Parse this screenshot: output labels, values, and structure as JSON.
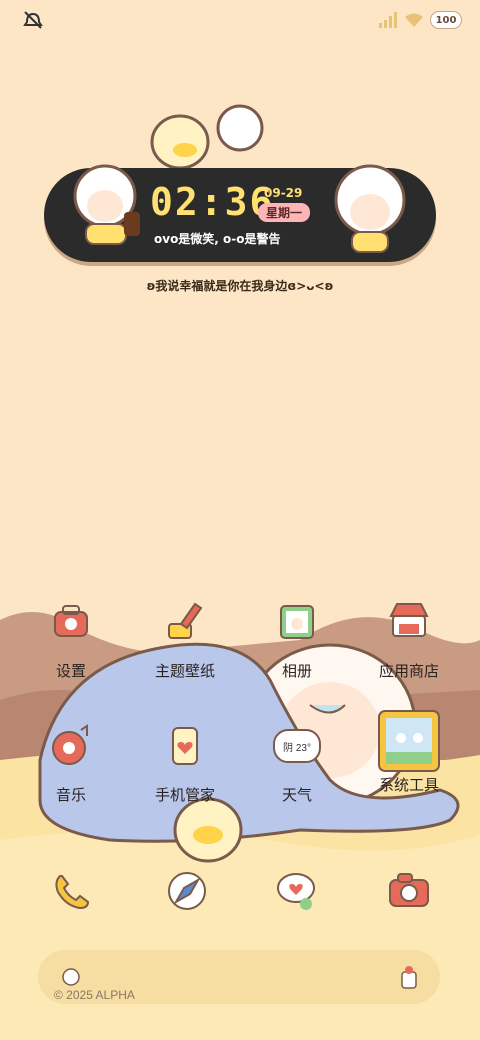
{
  "status_bar": {
    "battery_level": "100",
    "icons": [
      "mute-icon",
      "signal-icon",
      "wifi-icon",
      "battery-icon"
    ]
  },
  "clock_widget": {
    "time": "02:36",
    "date": "09-29",
    "weekday": "星期一",
    "tagline": "ovo是微笑, o-o是警告"
  },
  "caption": "ʚ我说幸福就是你在我身边ɞ>ᴗ<ʚ",
  "apps_row1": [
    {
      "label": "设置",
      "icon": "settings-icon"
    },
    {
      "label": "主题壁纸",
      "icon": "theme-wallpaper-icon"
    },
    {
      "label": "相册",
      "icon": "gallery-icon"
    },
    {
      "label": "应用商店",
      "icon": "app-store-icon"
    }
  ],
  "apps_row2": [
    {
      "label": "音乐",
      "icon": "music-icon"
    },
    {
      "label": "手机管家",
      "icon": "phone-manager-icon"
    },
    {
      "label": "天气",
      "icon": "weather-icon",
      "temp": "阴 23°"
    },
    {
      "label": "系统工具",
      "icon": "system-tools-icon"
    }
  ],
  "dock_apps": [
    {
      "icon": "phone-icon"
    },
    {
      "icon": "browser-icon"
    },
    {
      "icon": "messages-icon"
    },
    {
      "icon": "camera-icon"
    }
  ],
  "footer": "© 2025 ALPHA",
  "colors": {
    "background": "#fde6c6",
    "widget": "#2b2b2b",
    "time": "#ffe070",
    "dock": "#f6dea3",
    "blanket": "#b9c7ea",
    "hill": "#c99b83"
  }
}
